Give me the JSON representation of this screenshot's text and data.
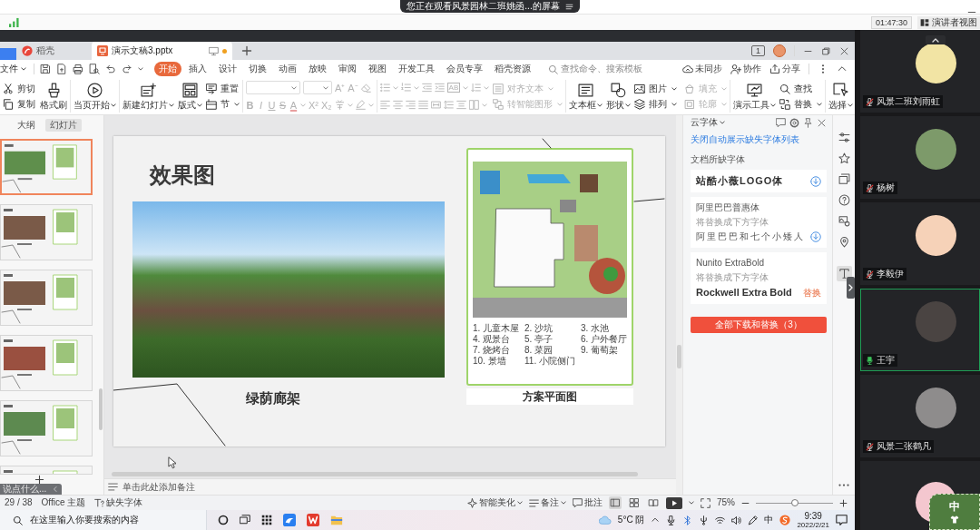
{
  "share_banner": {
    "text": "您正在观看风景园林二班姚函...的屏幕"
  },
  "meeting_bar": {
    "timer": "01:47:30",
    "presenter_view": "演讲者视图"
  },
  "window": {
    "tabs": [
      {
        "kind": "home",
        "label": "稻壳",
        "selected": false,
        "unsaved": false
      },
      {
        "kind": "document",
        "label": "演示文稿3.pptx",
        "selected": true,
        "unsaved": true
      }
    ],
    "badge": "1"
  },
  "menu": {
    "file": "文件",
    "tabs": [
      {
        "label": "开始",
        "selected": true
      },
      {
        "label": "插入",
        "selected": false
      },
      {
        "label": "设计",
        "selected": false
      },
      {
        "label": "切换",
        "selected": false
      },
      {
        "label": "动画",
        "selected": false
      },
      {
        "label": "放映",
        "selected": false
      },
      {
        "label": "审阅",
        "selected": false
      },
      {
        "label": "视图",
        "selected": false
      },
      {
        "label": "开发工具",
        "selected": false
      },
      {
        "label": "会员专享",
        "selected": false
      },
      {
        "label": "稻壳资源",
        "selected": false
      }
    ],
    "search": {
      "placeholder": "查找命令、搜索模板"
    },
    "actions": [
      "未同步",
      "协作",
      "分享"
    ]
  },
  "ribbon": {
    "text_formatting": {
      "disabled": true
    },
    "font_glyphs": [
      "A⁺",
      "A⁻",
      "B",
      "I",
      "U",
      "S",
      "A",
      "X²",
      "X₂"
    ],
    "paragraph_glyph": "AB",
    "tools": [
      {
        "label": "剪切",
        "disabled": false,
        "menu": false
      },
      {
        "label": "复制",
        "disabled": false,
        "menu": false
      },
      {
        "label": "格式刷",
        "disabled": false,
        "menu": false
      },
      {
        "label": "当页开始",
        "disabled": false,
        "menu": true
      },
      {
        "label": "新建幻灯片",
        "disabled": false,
        "menu": true
      },
      {
        "label": "版式",
        "disabled": false,
        "menu": true
      },
      {
        "label": "重置",
        "disabled": false,
        "menu": false
      },
      {
        "label": "节",
        "disabled": false,
        "menu": true
      },
      {
        "label": "对齐文本",
        "disabled": true,
        "menu": true
      },
      {
        "label": "转智能图形",
        "disabled": true,
        "menu": true
      },
      {
        "label": "文本框",
        "disabled": false,
        "menu": true
      },
      {
        "label": "形状",
        "disabled": false,
        "menu": true
      },
      {
        "label": "图片",
        "disabled": false,
        "menu": true
      },
      {
        "label": "排列",
        "disabled": false,
        "menu": true
      },
      {
        "label": "填充",
        "disabled": true,
        "menu": true
      },
      {
        "label": "轮廓",
        "disabled": true,
        "menu": true
      },
      {
        "label": "演示工具",
        "disabled": false,
        "menu": true
      },
      {
        "label": "查找",
        "disabled": false,
        "menu": false
      },
      {
        "label": "替换",
        "disabled": false,
        "menu": true
      },
      {
        "label": "选择",
        "disabled": false,
        "menu": true
      }
    ]
  },
  "slides_panel": {
    "tabs": [
      {
        "label": "大纲",
        "selected": false
      },
      {
        "label": "幻灯片",
        "selected": true
      }
    ],
    "thumbnails": [
      {
        "selected": true
      },
      {
        "selected": false
      },
      {
        "selected": false
      },
      {
        "selected": false
      },
      {
        "selected": false
      },
      {
        "selected": false
      }
    ]
  },
  "chat_input": {
    "placeholder": "说点什么..."
  },
  "slide": {
    "title": "效果图",
    "photo_caption": "绿荫廊架",
    "plan_caption": "方案平面图",
    "legend": [
      "1. 儿童木屋",
      "2. 沙坑",
      "3. 水池",
      "4. 观景台",
      "5. 亭子",
      "6. 户外餐厅",
      "7. 烧烤台",
      "8. 菜园",
      "9. 葡萄架",
      "10. 景墙",
      "11. 小院侧门"
    ]
  },
  "notes": {
    "placeholder": "单击此处添加备注"
  },
  "font_panel": {
    "title": "云字体",
    "link": "关闭自动展示缺失字体列表",
    "section": "文档所缺字体",
    "fonts": [
      {
        "kind": "download",
        "name": "站酷小薇LOGO体"
      },
      {
        "kind": "download",
        "name": "阿里巴巴普惠体",
        "hint": "将替换成下方字体",
        "replacement": "阿里巴巴和七个小矮人"
      },
      {
        "kind": "replace",
        "name": "Nunito ExtraBold",
        "hint": "将替换成下方字体",
        "replacement": "Rockwell Extra Bold",
        "action": "替换"
      }
    ],
    "button": "全部下载和替换（3）"
  },
  "side_tools": [
    {
      "selected": false
    },
    {
      "selected": false
    },
    {
      "selected": false
    },
    {
      "selected": false
    },
    {
      "selected": false
    },
    {
      "selected": false
    },
    {
      "selected": true
    }
  ],
  "status_bar": {
    "page": "29 / 38",
    "theme": "Office 主题",
    "missing_fonts": "缺失字体",
    "beautify": "智能美化",
    "notes": "备注",
    "comments": "批注",
    "views": [
      {
        "selected": true
      },
      {
        "selected": false
      },
      {
        "selected": false
      }
    ],
    "zoom": "75%",
    "zoom_slider": {
      "level": 0.5
    }
  },
  "taskbar": {
    "search": {
      "placeholder": "在这里输入你要搜索的内容"
    },
    "weather": "5°C 阴",
    "ime": "中",
    "time": "9:39",
    "date": "2022/2/21"
  },
  "participants": [
    {
      "name": "风景二班刘雨虹",
      "speaking": false
    },
    {
      "name": "杨树",
      "speaking": false
    },
    {
      "name": "李毅伊",
      "speaking": false
    },
    {
      "name": "王宇",
      "speaking": true
    },
    {
      "name": "风景二张鹤凡",
      "speaking": false
    },
    {
      "speaking": false
    }
  ],
  "ime_sticker": {
    "text": "中"
  }
}
